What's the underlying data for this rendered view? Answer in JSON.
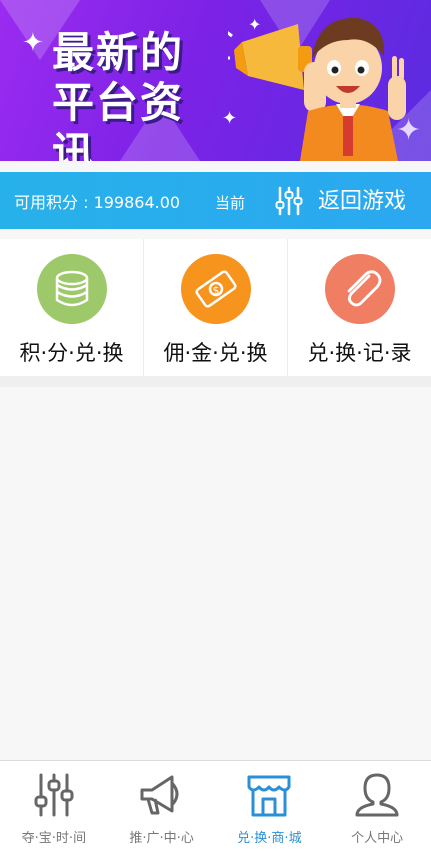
{
  "banner": {
    "line1": "最新的",
    "line2": "平台资讯",
    "colors": {
      "from": "#9b2bf0",
      "to": "#5a2ce0"
    },
    "mascot": "cartoon-man-with-megaphone"
  },
  "infobar": {
    "points_text": "可用积分 : 199864.00",
    "current_label": "当前",
    "return_label": "返回游戏",
    "return_icon": "equalizer-icon",
    "color": "#27b1ea"
  },
  "grid": {
    "items": [
      {
        "label": "积·分·兑·换",
        "icon": "database-icon",
        "color": "#9dc96a"
      },
      {
        "label": "佣·金·兑·换",
        "icon": "money-icon",
        "color": "#f7941d"
      },
      {
        "label": "兑·换·记·录",
        "icon": "paperclip-icon",
        "color": "#f07e62"
      }
    ]
  },
  "tabbar": {
    "active_color": "#2a8fd6",
    "items": [
      {
        "label": "夺·宝·时·间",
        "icon": "equalizer-icon",
        "active": false
      },
      {
        "label": "推·广·中·心",
        "icon": "megaphone-icon",
        "active": false
      },
      {
        "label": "兑·换·商·城",
        "icon": "store-icon",
        "active": true
      },
      {
        "label": "个人中心",
        "icon": "user-icon",
        "active": false
      }
    ]
  }
}
